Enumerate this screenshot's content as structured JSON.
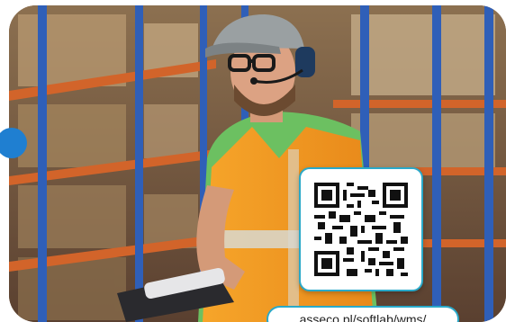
{
  "banner": {
    "url_text": "asseco.pl/softlab/wms/",
    "qr_alt": "QR code",
    "photo_alt": "Warehouse worker with headset and safety vest"
  },
  "icons": {
    "side_marker": "circle-dot",
    "qr": "qr-code-icon"
  },
  "colors": {
    "accent_blue": "#1f7fd1",
    "qr_border": "#2aa9c9",
    "vest_orange": "#f29a1f",
    "rack_blue": "#2f5fb8",
    "rack_orange": "#d2642a"
  }
}
